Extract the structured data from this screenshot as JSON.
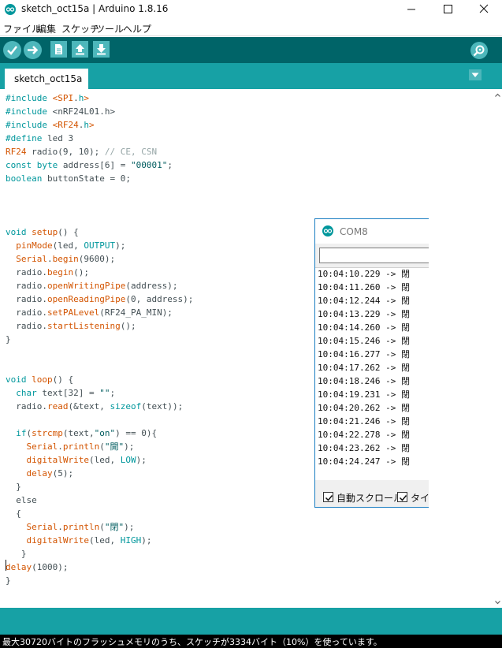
{
  "window": {
    "title": "sketch_oct15a | Arduino 1.8.16"
  },
  "menu": [
    "ファイル",
    "編集",
    "スケッチ",
    "ツール",
    "ヘルプ"
  ],
  "tab": {
    "label": "sketch_oct15a"
  },
  "code": [
    [
      [
        "kw",
        "#include "
      ],
      [
        "fn",
        "<SPI"
      ],
      [
        "",
        "."
      ],
      [
        "kw",
        "h"
      ],
      [
        "fn",
        ">"
      ]
    ],
    [
      [
        "kw",
        "#include "
      ],
      [
        "",
        "<nRF24L01.h>"
      ]
    ],
    [
      [
        "kw",
        "#include "
      ],
      [
        "fn",
        "<RF24"
      ],
      [
        "",
        "."
      ],
      [
        "kw",
        "h"
      ],
      [
        "fn",
        ">"
      ]
    ],
    [
      [
        "kw",
        "#define "
      ],
      [
        "",
        "led 3"
      ]
    ],
    [
      [
        "fn",
        "RF24"
      ],
      [
        "",
        " radio(9, 10); "
      ],
      [
        "cm",
        "// CE, CSN"
      ]
    ],
    [
      [
        "kw",
        "const byte"
      ],
      [
        "",
        " address[6] = "
      ],
      [
        "str",
        "\"00001\""
      ],
      [
        "",
        ";"
      ]
    ],
    [
      [
        "kw",
        "boolean"
      ],
      [
        "",
        " buttonState = 0;"
      ]
    ],
    [],
    [],
    [],
    [
      [
        "kw",
        "void"
      ],
      [
        "fn",
        " setup"
      ],
      [
        "",
        "() {"
      ]
    ],
    [
      [
        "",
        "  "
      ],
      [
        "fn",
        "pinMode"
      ],
      [
        "",
        "(led, "
      ],
      [
        "kw",
        "OUTPUT"
      ],
      [
        "",
        ");"
      ]
    ],
    [
      [
        "",
        "  "
      ],
      [
        "fn",
        "Serial"
      ],
      [
        "",
        "."
      ],
      [
        "fn",
        "begin"
      ],
      [
        "",
        "(9600);"
      ]
    ],
    [
      [
        "",
        "  radio."
      ],
      [
        "fn",
        "begin"
      ],
      [
        "",
        "();"
      ]
    ],
    [
      [
        "",
        "  radio."
      ],
      [
        "fn",
        "openWritingPipe"
      ],
      [
        "",
        "(address);"
      ]
    ],
    [
      [
        "",
        "  radio."
      ],
      [
        "fn",
        "openReadingPipe"
      ],
      [
        "",
        "(0, address);"
      ]
    ],
    [
      [
        "",
        "  radio."
      ],
      [
        "fn",
        "setPALevel"
      ],
      [
        "",
        "(RF24_PA_MIN);"
      ]
    ],
    [
      [
        "",
        "  radio."
      ],
      [
        "fn",
        "startListening"
      ],
      [
        "",
        "();"
      ]
    ],
    [
      [
        "",
        "}"
      ]
    ],
    [],
    [],
    [
      [
        "kw",
        "void"
      ],
      [
        "fn",
        " loop"
      ],
      [
        "",
        "() {"
      ]
    ],
    [
      [
        "",
        "  "
      ],
      [
        "kw",
        "char"
      ],
      [
        "",
        " text[32] = "
      ],
      [
        "str",
        "\"\""
      ],
      [
        "",
        ";"
      ]
    ],
    [
      [
        "",
        "  radio."
      ],
      [
        "fn",
        "read"
      ],
      [
        "",
        "(&text, "
      ],
      [
        "kw",
        "sizeof"
      ],
      [
        "",
        "(text));"
      ]
    ],
    [],
    [
      [
        "",
        "  "
      ],
      [
        "kw",
        "if"
      ],
      [
        "",
        "("
      ],
      [
        "fn",
        "strcmp"
      ],
      [
        "",
        "(text,"
      ],
      [
        "str",
        "\"on\""
      ],
      [
        "",
        ") == 0){"
      ]
    ],
    [
      [
        "",
        "    "
      ],
      [
        "fn",
        "Serial"
      ],
      [
        "",
        "."
      ],
      [
        "fn",
        "println"
      ],
      [
        "",
        "("
      ],
      [
        "str",
        "\"開\""
      ],
      [
        "",
        ");"
      ]
    ],
    [
      [
        "",
        "    "
      ],
      [
        "fn",
        "digitalWrite"
      ],
      [
        "",
        "(led, "
      ],
      [
        "kw",
        "LOW"
      ],
      [
        "",
        ");"
      ]
    ],
    [
      [
        "",
        "    "
      ],
      [
        "fn",
        "delay"
      ],
      [
        "",
        "(5);"
      ]
    ],
    [
      [
        "",
        "  }"
      ]
    ],
    [
      [
        "",
        "  else"
      ]
    ],
    [
      [
        "",
        "  {"
      ]
    ],
    [
      [
        "",
        "    "
      ],
      [
        "fn",
        "Serial"
      ],
      [
        "",
        "."
      ],
      [
        "fn",
        "println"
      ],
      [
        "",
        "("
      ],
      [
        "str",
        "\"閉\""
      ],
      [
        "",
        ");"
      ]
    ],
    [
      [
        "",
        "    "
      ],
      [
        "fn",
        "digitalWrite"
      ],
      [
        "",
        "(led, "
      ],
      [
        "kw",
        "HIGH"
      ],
      [
        "",
        ");"
      ]
    ],
    [
      [
        "",
        "   }"
      ]
    ],
    [
      [
        "fn",
        "delay"
      ],
      [
        "",
        "(1000);"
      ]
    ],
    [
      [
        "",
        "}"
      ]
    ]
  ],
  "serial_monitor": {
    "title": "COM8",
    "input_value": "",
    "lines": [
      "10:04:10.229 -> 閉",
      "10:04:11.260 -> 閉",
      "10:04:12.244 -> 閉",
      "10:04:13.229 -> 閉",
      "10:04:14.260 -> 閉",
      "10:04:15.246 -> 閉",
      "10:04:16.277 -> 閉",
      "10:04:17.262 -> 閉",
      "10:04:18.246 -> 閉",
      "10:04:19.231 -> 閉",
      "10:04:20.262 -> 閉",
      "10:04:21.246 -> 閉",
      "10:04:22.278 -> 閉",
      "10:04:23.262 -> 閉",
      "10:04:24.247 -> 閉"
    ],
    "autoscroll_label": "自動スクロール",
    "timestamp_label": "タイム",
    "autoscroll_checked": true,
    "timestamp_checked": true
  },
  "status": {
    "text": "最大30720バイトのフラッシュメモリのうち、スケッチが3334バイト（10%）を使っています。"
  },
  "colors": {
    "toolbar": "#006468",
    "tabbar": "#17a1a5",
    "button": "#4db7bb"
  },
  "icons": [
    "arduino-icon",
    "minimize-icon",
    "maximize-icon",
    "close-icon",
    "verify-icon",
    "upload-icon",
    "new-icon",
    "open-icon",
    "save-icon",
    "serial-monitor-icon",
    "tab-menu-icon"
  ]
}
